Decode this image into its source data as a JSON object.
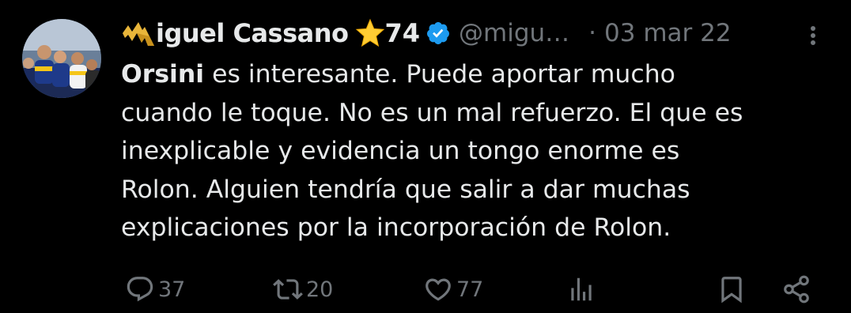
{
  "author": {
    "display_name": "iguel Cassano",
    "name_suffix": "74",
    "handle": "@migu…",
    "separator": "·",
    "date": "03 mar 22",
    "logo_icon": "gold-m-logo",
    "badge_icon": "star-emoji",
    "verified_icon": "verified-badge-icon",
    "verified_color": "#1d9bf0",
    "avatar_alt": "profile photo"
  },
  "body": {
    "bold_word": "Orsini",
    "line1_rest": " es interesante. Puede aportar mucho",
    "line2": "cuando le toque. No es un mal refuerzo. El que es",
    "line3": "inexplicable y evidencia un tongo enorme es",
    "line4": "Rolon. Alguien tendría que salir a dar muchas",
    "line5": "explicaciones por la incorporación de Rolon."
  },
  "actions": {
    "replies": "37",
    "reposts": "20",
    "likes": "77"
  },
  "colors": {
    "background": "#000000",
    "text": "#e7e9ea",
    "muted": "#71767b"
  }
}
